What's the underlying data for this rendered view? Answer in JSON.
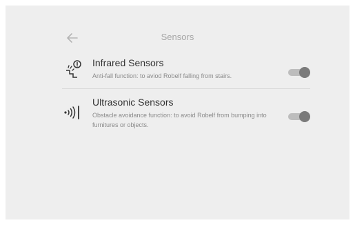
{
  "header": {
    "title": "Sensors",
    "back_icon": "arrow-left-icon"
  },
  "sensors": [
    {
      "title": "Infrared Sensors",
      "description": "Anti-fall function: to aviod Robelf falling from stairs.",
      "icon": "stairs-warning-icon",
      "enabled": true
    },
    {
      "title": "Ultrasonic Sensors",
      "description": "Obstacle avoidance function: to avoid Robelf from bumping into furnitures or objects.",
      "icon": "ultrasonic-wave-icon",
      "enabled": true
    }
  ],
  "colors": {
    "background": "#eeeeee",
    "title": "#a6a6a6",
    "toggle_track": "#bdbdbd",
    "toggle_knob": "#7a7a7a"
  }
}
